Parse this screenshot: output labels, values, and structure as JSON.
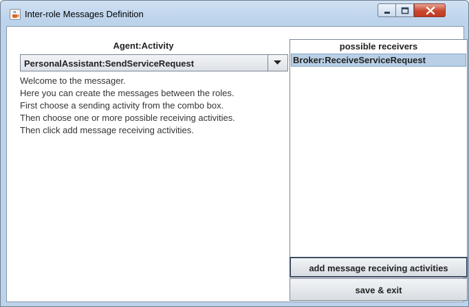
{
  "window": {
    "title": "Inter-role Messages Definition",
    "icon": "java-cup-icon"
  },
  "left": {
    "heading": "Agent:Activity",
    "combo_value": "PersonalAssistant:SendServiceRequest",
    "welcome_lines": [
      "Welcome to the messager.",
      "Here you can create the messages between the roles.",
      "First choose a sending activity from the combo box.",
      "Then choose one or more possible receiving activities.",
      "Then click add message receiving activities."
    ]
  },
  "receivers": {
    "heading": "possible receivers",
    "items": [
      "Broker:ReceiveServiceRequest"
    ]
  },
  "buttons": {
    "add": "add message receiving activities",
    "save": "save & exit"
  },
  "colors": {
    "selection": "#b8cfe5",
    "close_button": "#c9472e"
  }
}
